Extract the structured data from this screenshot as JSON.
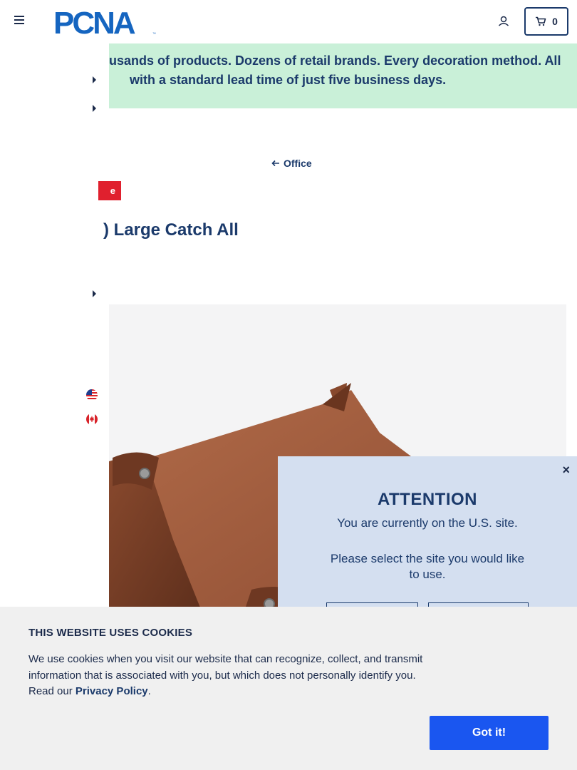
{
  "header": {
    "logo_text": "PCNA",
    "cart_count": "0"
  },
  "banner": {
    "line1": "usands of products. Dozens of retail brands. Every decoration method. All",
    "line2": "with a standard lead time of just five business days."
  },
  "breadcrumb": {
    "label": "Office"
  },
  "product": {
    "badge": "e",
    "title": ") Large Catch All"
  },
  "modal": {
    "close_label": "×",
    "title": "ATTENTION",
    "current_site": "You are currently on the U.S. site.",
    "prompt": "Please select the site you would like to use."
  },
  "cookie": {
    "title": "THIS WEBSITE USES COOKIES",
    "text": "We use cookies when you visit our website that can recognize, collect, and transmit information that is associated with you, but which does not personally identify you. Read our",
    "link": "Privacy Policy",
    "period": ".",
    "button": "Got it!"
  },
  "icons": [
    "menu-icon",
    "user-icon",
    "cart-icon",
    "caret-right-icon",
    "us-flag-icon",
    "canada-flag-icon",
    "arrow-left-icon",
    "close-icon"
  ],
  "colors": {
    "brand_navy": "#1b3a6b",
    "banner_bg": "#c9f0d8",
    "modal_bg": "#d4dff0",
    "badge_red": "#e0202e",
    "cookie_button": "#1a56f0"
  }
}
